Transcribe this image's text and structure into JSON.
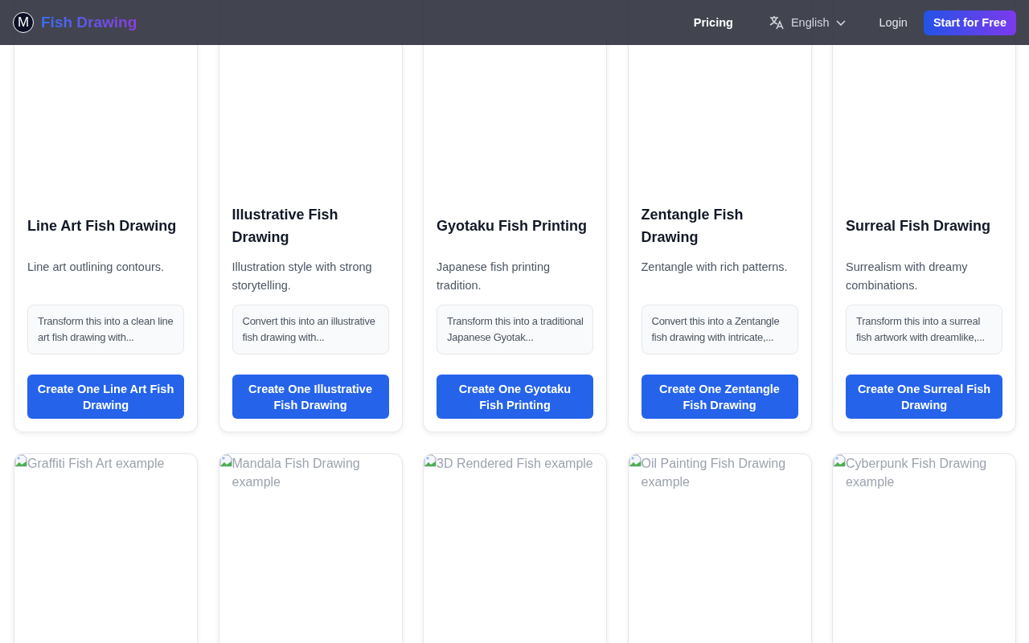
{
  "header": {
    "logo_letter": "M",
    "brand": "Fish Drawing",
    "nav": [
      {
        "label": "Pricing",
        "kind": "link"
      },
      {
        "label": "English",
        "kind": "language"
      },
      {
        "label": "Login",
        "kind": "link"
      }
    ],
    "cta": "Start for Free"
  },
  "cards": [
    {
      "title": "Line Art Fish Drawing",
      "description": "Line art outlining contours.",
      "prompt": "Transform this into a clean line art fish drawing with...",
      "button": "Create One Line Art Fish Drawing"
    },
    {
      "title": "Illustrative Fish Drawing",
      "description": "Illustration style with strong storytelling.",
      "prompt": "Convert this into an illustrative fish drawing with...",
      "button": "Create One Illustrative Fish Drawing"
    },
    {
      "title": "Gyotaku Fish Printing",
      "description": "Japanese fish printing tradition.",
      "prompt": "Transform this into a traditional Japanese Gyotak...",
      "button": "Create One Gyotaku Fish Printing"
    },
    {
      "title": "Zentangle Fish Drawing",
      "description": "Zentangle with rich patterns.",
      "prompt": "Convert this into a Zentangle fish drawing with intricate,...",
      "button": "Create One Zentangle Fish Drawing"
    },
    {
      "title": "Surreal Fish Drawing",
      "description": "Surrealism with dreamy combinations.",
      "prompt": "Transform this into a surreal fish artwork with dreamlike,...",
      "button": "Create One Surreal Fish Drawing"
    }
  ],
  "more_cards": [
    {
      "image_alt": "Graffiti Fish Art example"
    },
    {
      "image_alt": "Mandala Fish Drawing example"
    },
    {
      "image_alt": "3D Rendered Fish example"
    },
    {
      "image_alt": "Oil Painting Fish Drawing example"
    },
    {
      "image_alt": "Cyberpunk Fish Drawing example"
    }
  ]
}
